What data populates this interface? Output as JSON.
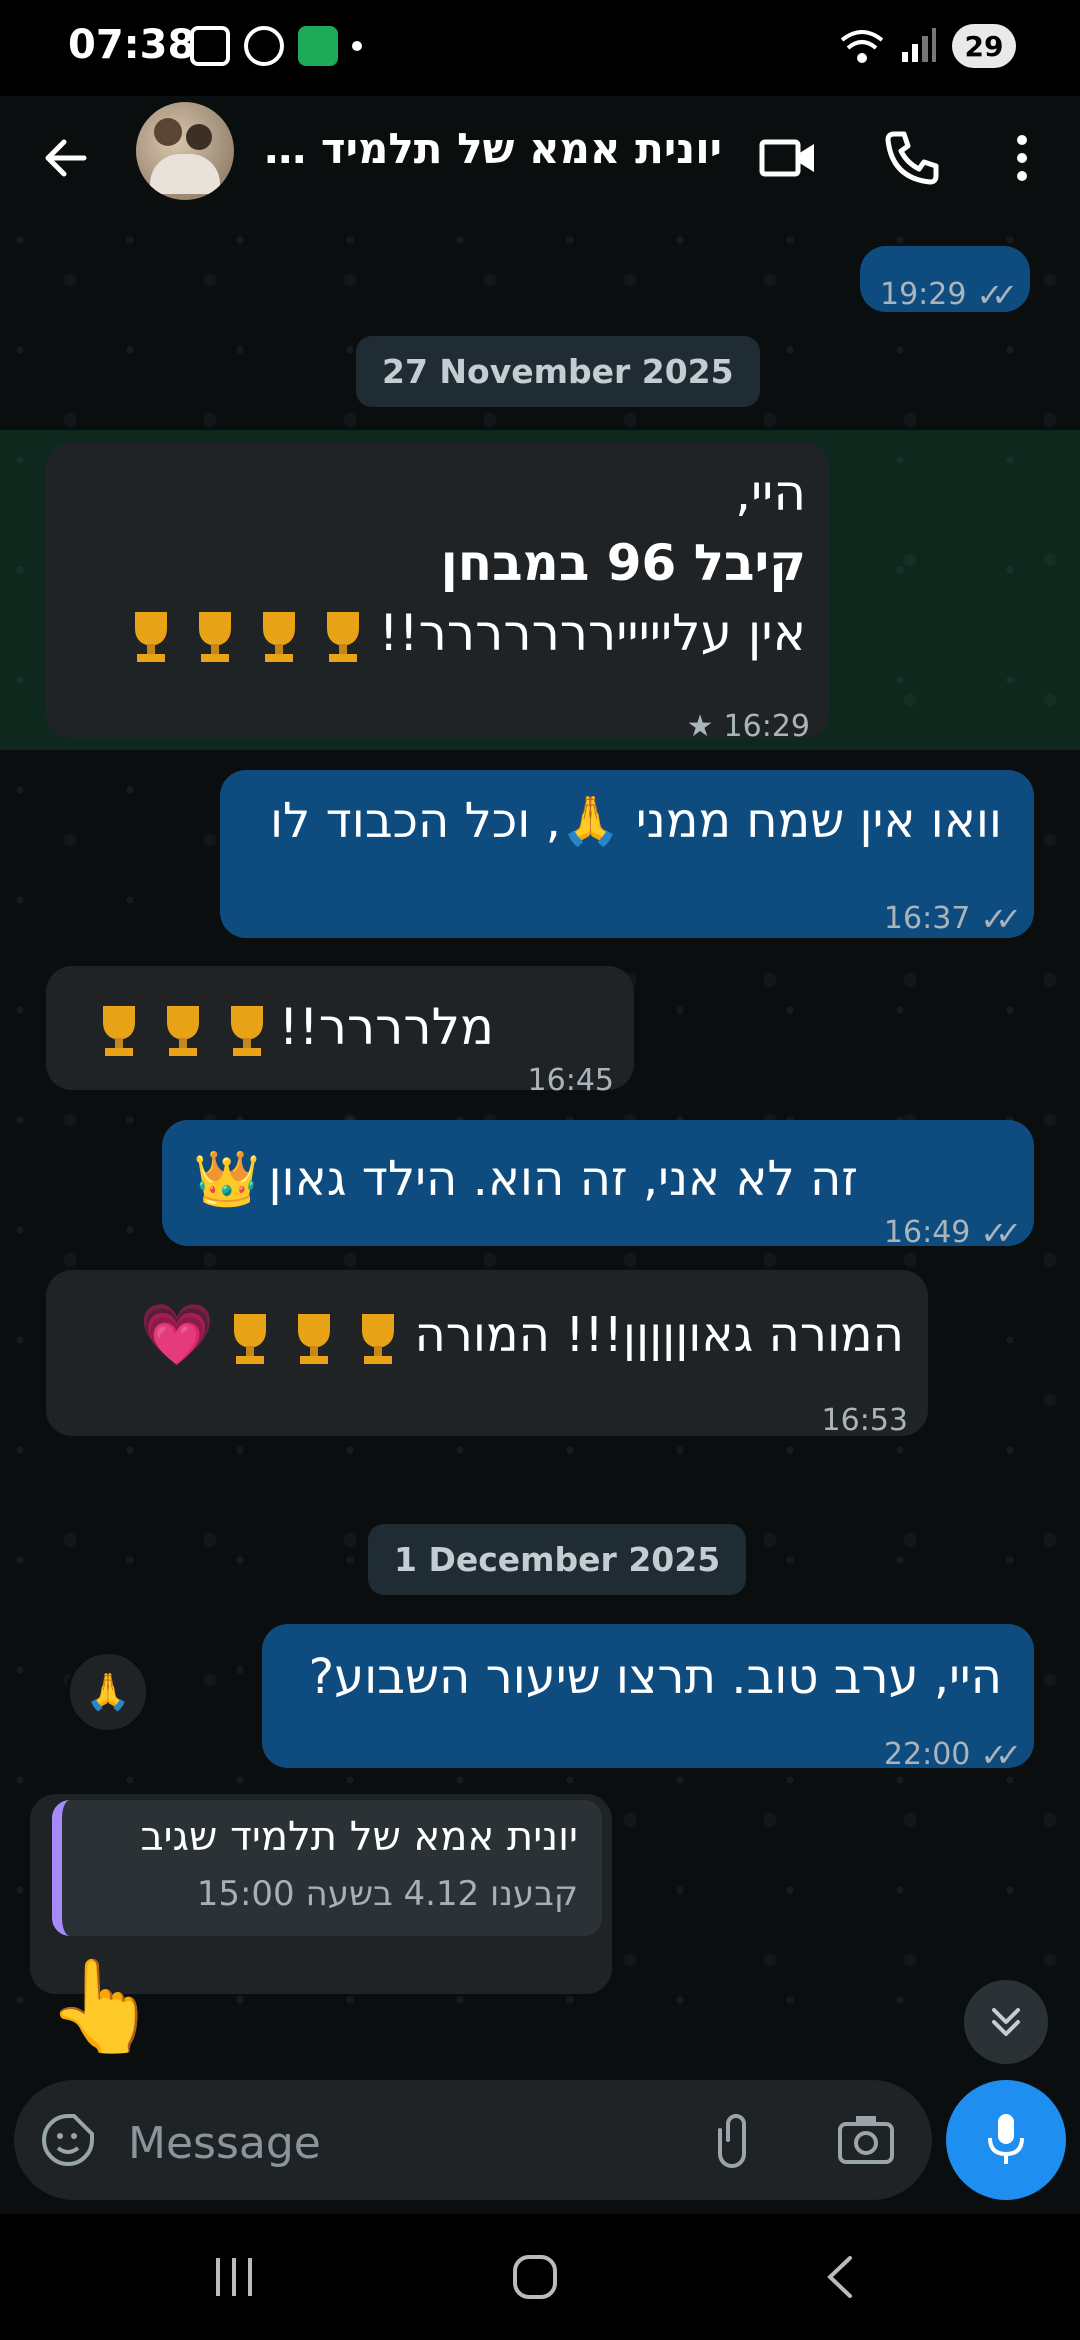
{
  "status_bar": {
    "time": "07:38",
    "battery": "29"
  },
  "header": {
    "contact_name": "יונית אמא של תלמיד ש..."
  },
  "chat": {
    "prev_time": "19:29",
    "date1": "27 November 2025",
    "msg1": {
      "line1": "היי,",
      "line2": "קיבל 96 במבחן",
      "line3": "אין עליייייררררררר!!",
      "time": "16:29",
      "trophies": 4
    },
    "msg2": {
      "text": "וואו אין שמח ממני 🙏, וכל הכבוד לו",
      "time": "16:37"
    },
    "msg3": {
      "text": "מלרררר!!",
      "time": "16:45",
      "trophies": 3
    },
    "msg4": {
      "text": "זה לא אני, זה הוא. הילד גאון",
      "emoji": "👑",
      "time": "16:49"
    },
    "msg5": {
      "text": "המורה גאוןןןןן!!! המורה",
      "time": "16:53",
      "trophies": 3,
      "heart": "💗",
      "reaction": "🙏"
    },
    "date2": "1 December 2025",
    "msg6": {
      "text": "היי, ערב טוב. תרצו שיעור השבוע?",
      "time": "22:00"
    },
    "reply": {
      "quote_name": "יונית אמא של תלמיד שגיב",
      "quote_text": "קבענו 4.12 בשעה 15:00",
      "emoji": "👆"
    }
  },
  "composer": {
    "placeholder": "Message"
  },
  "colors": {
    "outgoing": "#0e4c7f",
    "incoming": "#1f2326",
    "accent": "#1f8ef1"
  }
}
